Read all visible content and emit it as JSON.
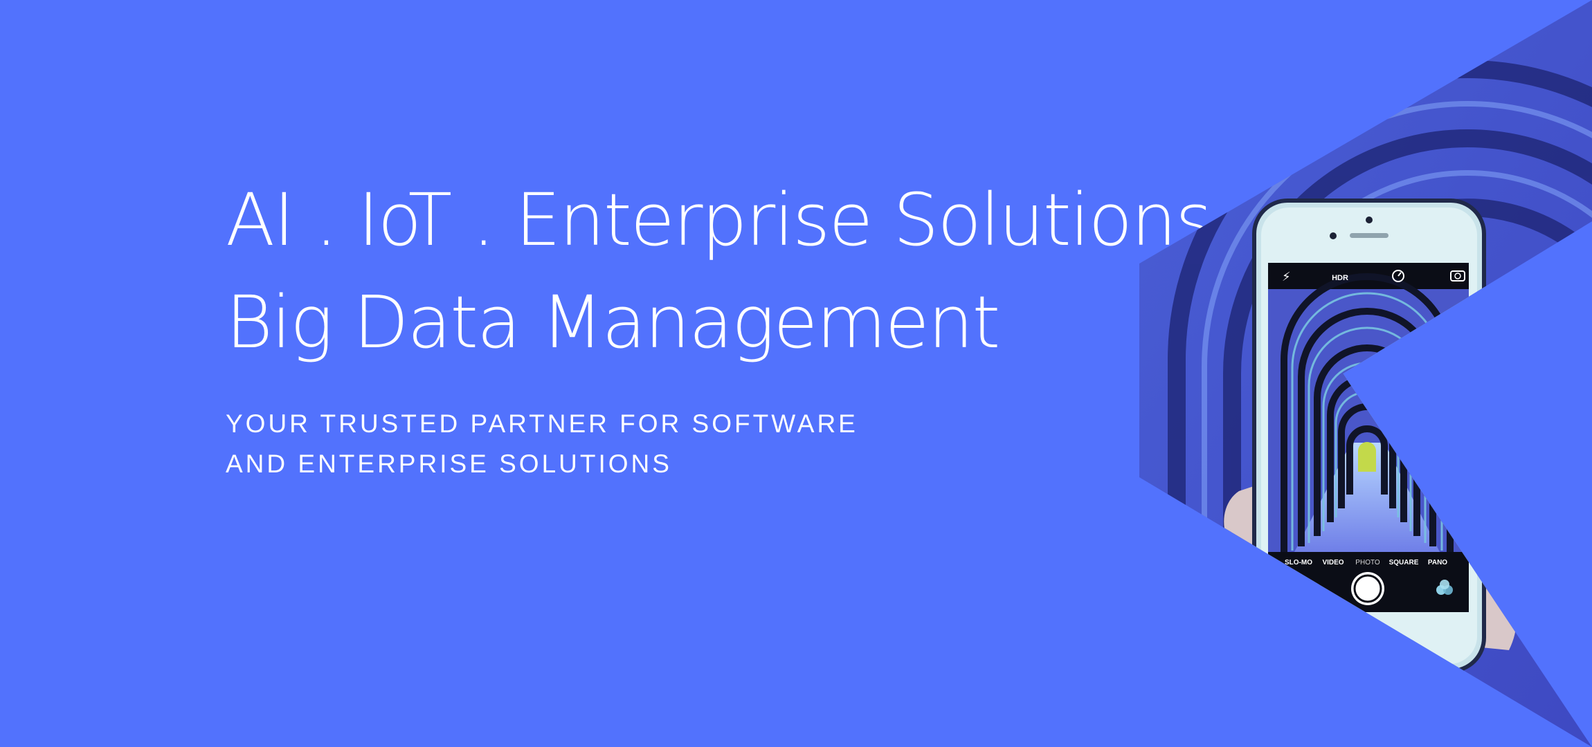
{
  "hero": {
    "headline_line1": "AI . IoT . Enterprise Solutions",
    "headline_line2": "Big Data Management",
    "tagline_line1": "YOUR TRUSTED PARTNER FOR SOFTWARE",
    "tagline_line2": "AND ENTERPRISE SOLUTIONS"
  },
  "phone_camera": {
    "top_icons": [
      "flash-off-icon",
      "hdr-label",
      "timer-icon",
      "flip-camera-icon"
    ],
    "hdr_label": "HDR",
    "modes": [
      "SLO-MO",
      "VIDEO",
      "PHOTO",
      "SQUARE",
      "PANO"
    ],
    "selected_mode": "PHOTO"
  },
  "colors": {
    "background": "#5272FD",
    "text": "#ffffff",
    "tunnel_glow": "#C3D94A"
  }
}
